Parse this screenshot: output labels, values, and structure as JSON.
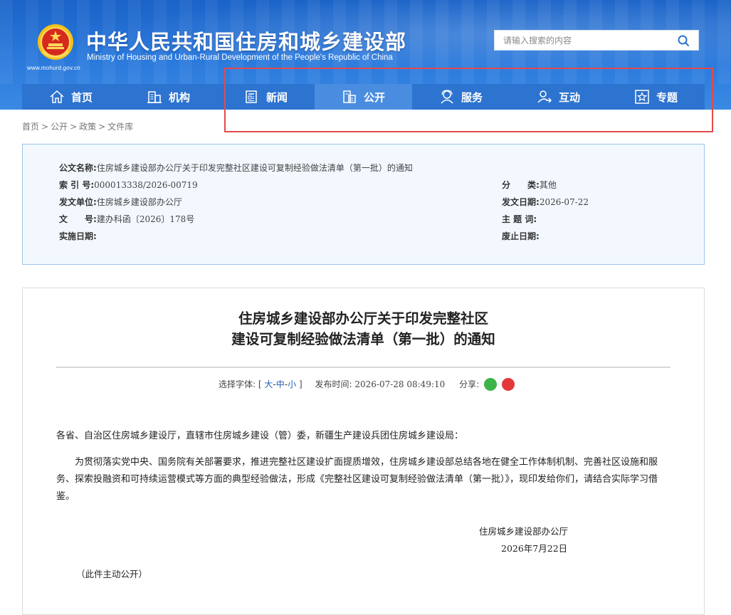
{
  "header": {
    "site_title": "中华人民共和国住房和城乡建设部",
    "site_subtitle": "Ministry of Housing and Urban-Rural Development of the People's Republic of China",
    "site_url": "www.mohurd.gov.cn",
    "search_placeholder": "请输入搜索的内容"
  },
  "nav": {
    "items": [
      {
        "label": "首页",
        "icon": "home-icon"
      },
      {
        "label": "机构",
        "icon": "building-icon"
      },
      {
        "label": "新闻",
        "icon": "news-icon"
      },
      {
        "label": "公开",
        "icon": "disclosure-icon",
        "active": true
      },
      {
        "label": "服务",
        "icon": "service-icon"
      },
      {
        "label": "互动",
        "icon": "interaction-icon"
      },
      {
        "label": "专题",
        "icon": "star-icon"
      }
    ]
  },
  "breadcrumb": [
    "首页",
    "公开",
    "政策",
    "文件库"
  ],
  "meta": {
    "title_label": "公文名称:",
    "title_value": "住房城乡建设部办公厅关于印发完整社区建设可复制经验做法清单（第一批）的通知",
    "index_label": "索 引 号:",
    "index_value": "000013338/2026-00719",
    "issuer_label": "发文单位:",
    "issuer_value": "住房城乡建设部办公厅",
    "docno_label": "文　　号:",
    "docno_value": "建办科函〔2026〕178号",
    "effective_label": "实施日期:",
    "category_label": "分　　类:",
    "category_value": "其他",
    "date_label": "发文日期:",
    "date_value": "2026-07-22",
    "keywords_label": "主 题 词:",
    "expiry_label": "废止日期:"
  },
  "article": {
    "title_line1": "住房城乡建设部办公厅关于印发完整社区",
    "title_line2": "建设可复制经验做法清单（第一批）的通知",
    "font_label": "选择字体:",
    "font_open": "[",
    "font_large": "大",
    "font_medium": "中",
    "font_small": "小",
    "font_dash": "-",
    "font_close": "]",
    "publish_label": "发布时间:",
    "publish_time": "2026-07-28 08:49:10",
    "share_label": "分享:",
    "recipients": "各省、自治区住房城乡建设厅，直辖市住房城乡建设（管）委，新疆生产建设兵团住房城乡建设局：",
    "body": "为贯彻落实党中央、国务院有关部署要求，推进完整社区建设扩面提质增效，住房城乡建设部总结各地在健全工作体制机制、完善社区设施和服务、探索投融资和可持续运营模式等方面的典型经验做法，形成《完整社区建设可复制经验做法清单（第一批）》，现印发给你们，请结合实际学习借鉴。",
    "signer": "住房城乡建设部办公厅",
    "sign_date": "2026年7月22日",
    "note": "（此件主动公开）"
  },
  "colors": {
    "header_blue": "#1b63c8",
    "nav_blue": "#2d73d0",
    "nav_active": "#4a8de0",
    "meta_bg": "#f2f8fe",
    "meta_border": "#9fc6ea",
    "highlight": "#e34a4a",
    "link": "#1f5fb8"
  }
}
